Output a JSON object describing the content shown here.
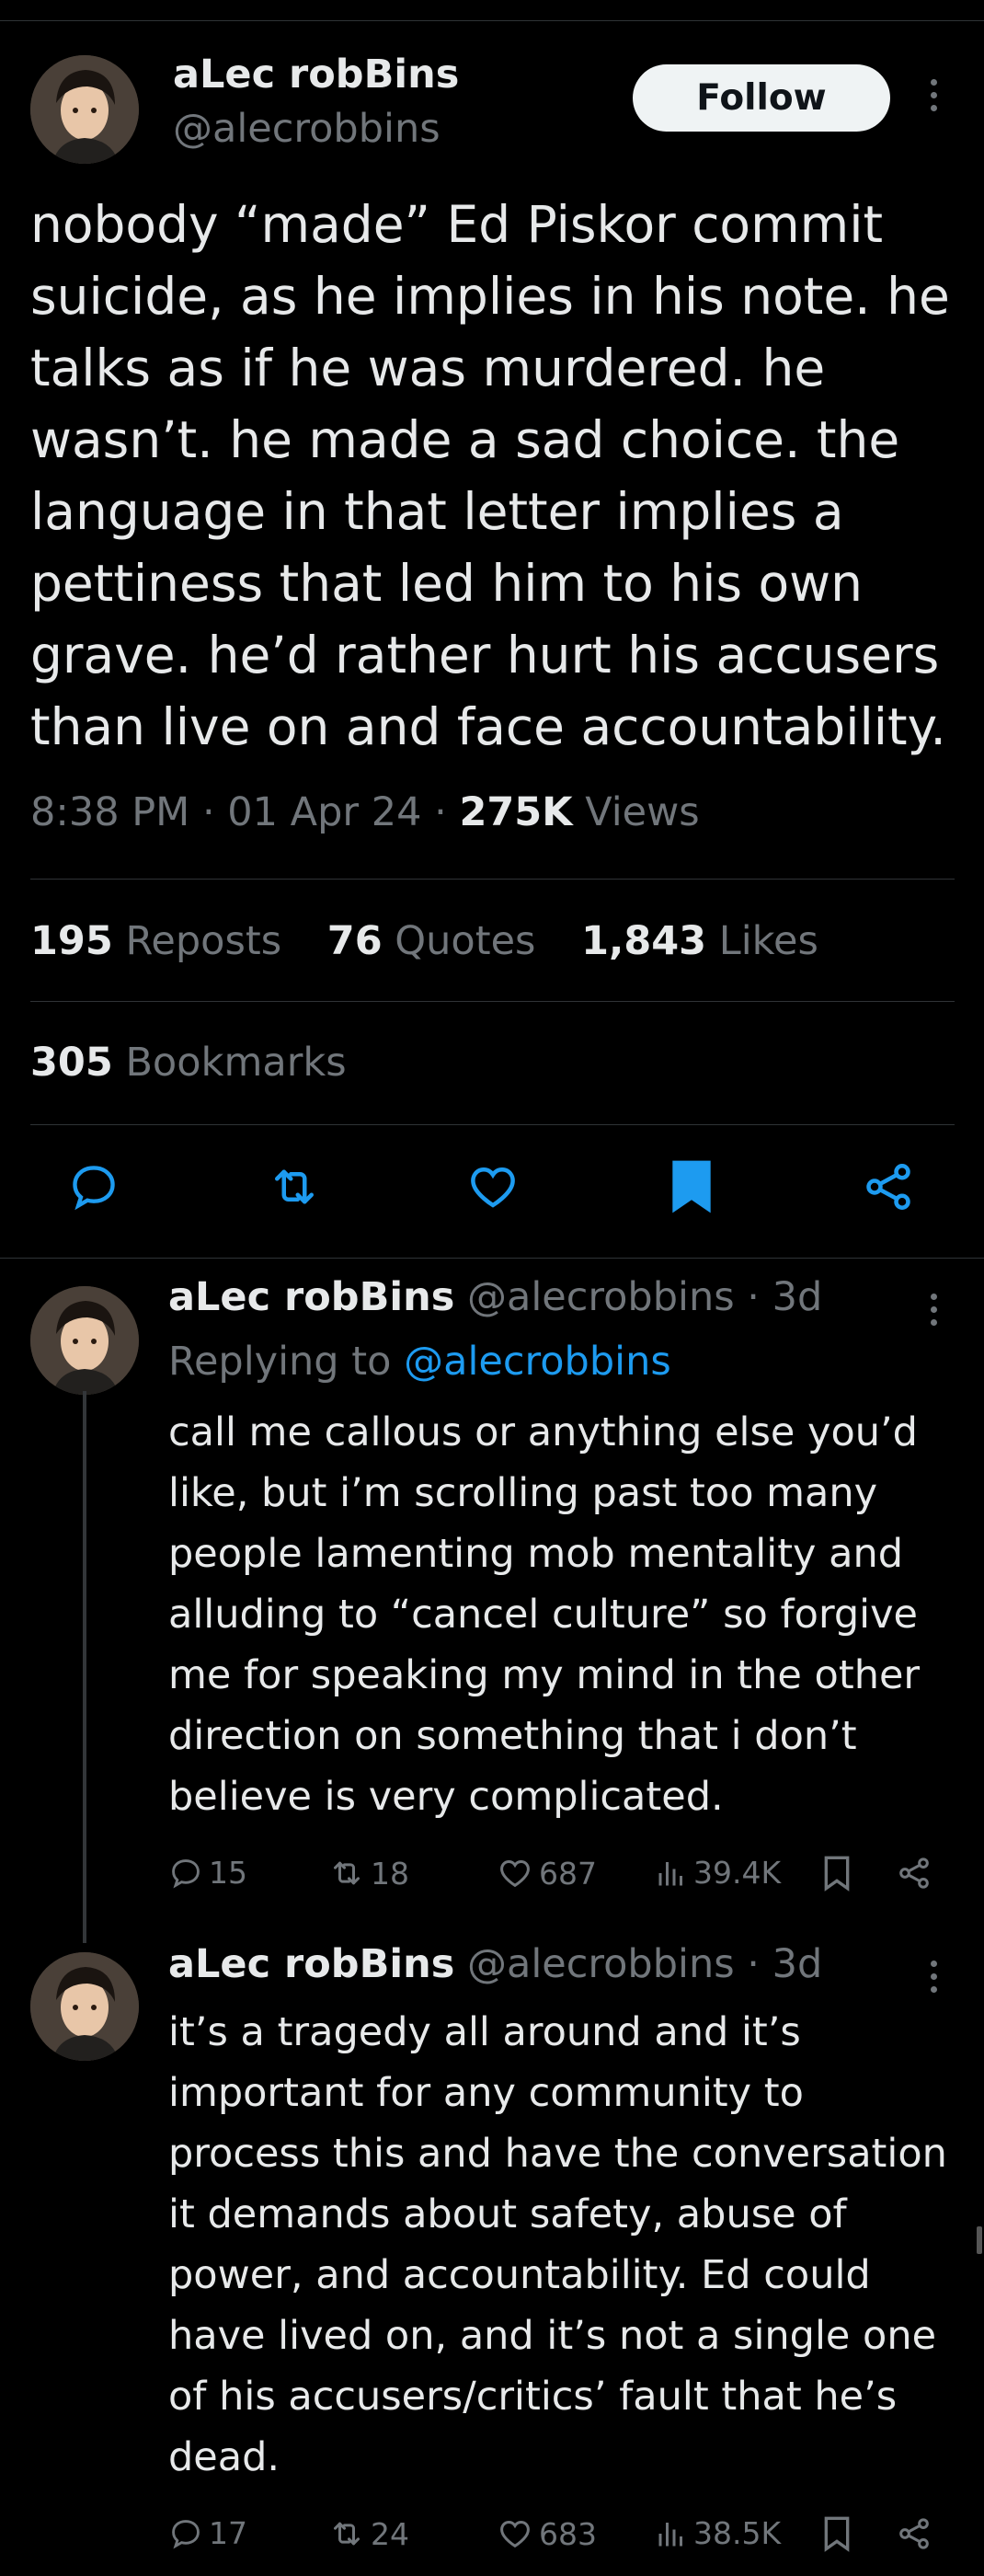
{
  "main_tweet": {
    "author_name": "aLec robBins",
    "author_handle": "@alecrobbins",
    "follow_label": "Follow",
    "text": "nobody “made” Ed Piskor commit suicide, as he implies in his note. he talks as if he was murdered. he wasn’t. he made a sad choice. the language in that letter implies a pettiness that led him to his own grave. he’d rather hurt his accusers than live on and face accountability.",
    "time": "8:38 PM",
    "date": "01 Apr 24",
    "views_count": "275K",
    "views_label": "Views",
    "reposts_count": "195",
    "reposts_label": "Reposts",
    "quotes_count": "76",
    "quotes_label": "Quotes",
    "likes_count": "1,843",
    "likes_label": "Likes",
    "bookmarks_count": "305",
    "bookmarks_label": "Bookmarks",
    "actions": [
      "reply-icon",
      "repost-icon",
      "like-icon",
      "bookmark-icon",
      "share-icon"
    ],
    "bookmark_active_color": "#1d9bf0"
  },
  "replies": [
    {
      "author_name": "aLec robBins",
      "author_handle": "@alecrobbins",
      "time_ago": "· 3d",
      "replying_prefix": "Replying to",
      "replying_handle": "@alecrobbins",
      "text": "call me callous or anything else you’d like, but i’m scrolling past too many people lamenting mob mentality and alluding to “cancel culture” so forgive me for speaking my mind in the other direction on something that i don’t believe is very complicated.",
      "replies": "15",
      "reposts": "18",
      "likes": "687",
      "views": "39.4K"
    },
    {
      "author_name": "aLec robBins",
      "author_handle": "@alecrobbins",
      "time_ago": "· 3d",
      "text": "it’s a tragedy all around and it’s important for any community to process this and have the conversation it demands about safety, abuse of power, and accountability. Ed could have lived on, and it’s not a single one of his accusers/critics’ fault that he’s dead.",
      "replies": "17",
      "reposts": "24",
      "likes": "683",
      "views": "38.5K"
    }
  ],
  "colors": {
    "background": "#000000",
    "text_primary": "#e7e9ea",
    "text_secondary": "#71767b",
    "link": "#1d9bf0",
    "divider": "#2f3336"
  }
}
